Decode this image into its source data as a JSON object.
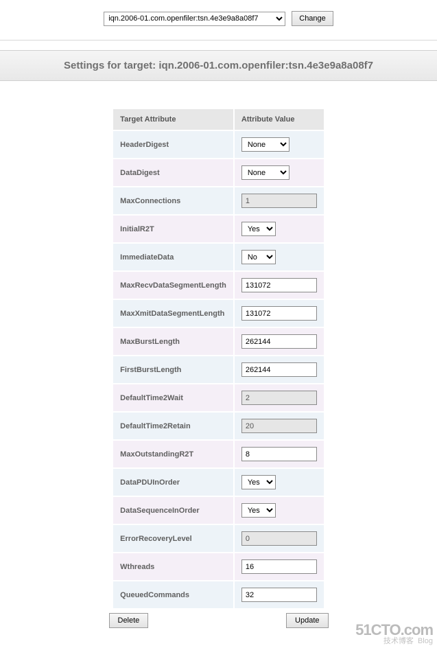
{
  "selector": {
    "selected": "iqn.2006-01.com.openfiler:tsn.4e3e9a8a08f7",
    "change_label": "Change"
  },
  "header_prefix": "Settings for target: ",
  "header_target": "iqn.2006-01.com.openfiler:tsn.4e3e9a8a08f7",
  "columns": {
    "attr": "Target Attribute",
    "val": "Attribute Value"
  },
  "rows": [
    {
      "name": "HeaderDigest",
      "type": "select_wide",
      "value": "None"
    },
    {
      "name": "DataDigest",
      "type": "select_wide",
      "value": "None"
    },
    {
      "name": "MaxConnections",
      "type": "readonly",
      "value": "1"
    },
    {
      "name": "InitialR2T",
      "type": "select_narrow",
      "value": "Yes"
    },
    {
      "name": "ImmediateData",
      "type": "select_narrow",
      "value": "No"
    },
    {
      "name": "MaxRecvDataSegmentLength",
      "type": "text",
      "value": "131072"
    },
    {
      "name": "MaxXmitDataSegmentLength",
      "type": "text",
      "value": "131072"
    },
    {
      "name": "MaxBurstLength",
      "type": "text",
      "value": "262144"
    },
    {
      "name": "FirstBurstLength",
      "type": "text",
      "value": "262144"
    },
    {
      "name": "DefaultTime2Wait",
      "type": "readonly",
      "value": "2"
    },
    {
      "name": "DefaultTime2Retain",
      "type": "readonly",
      "value": "20"
    },
    {
      "name": "MaxOutstandingR2T",
      "type": "text",
      "value": "8"
    },
    {
      "name": "DataPDUInOrder",
      "type": "select_narrow",
      "value": "Yes"
    },
    {
      "name": "DataSequenceInOrder",
      "type": "select_narrow",
      "value": "Yes"
    },
    {
      "name": "ErrorRecoveryLevel",
      "type": "readonly",
      "value": "0"
    },
    {
      "name": "Wthreads",
      "type": "text",
      "value": "16"
    },
    {
      "name": "QueuedCommands",
      "type": "text",
      "value": "32"
    }
  ],
  "buttons": {
    "delete": "Delete",
    "update": "Update"
  },
  "watermark": {
    "line1": "51CTO.com",
    "line2_a": "技术博客",
    "line2_b": "Blog"
  }
}
